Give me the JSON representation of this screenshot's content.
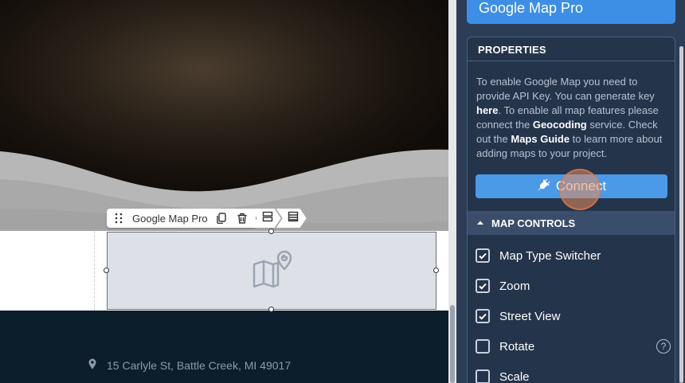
{
  "canvas": {
    "toolbar": {
      "element_label": "Google Map Pro"
    },
    "footer": {
      "address": "15 Carlyle St, Battle Creek, MI 49017"
    }
  },
  "panel": {
    "title": "Google Map Pro",
    "properties": {
      "header": "PROPERTIES",
      "desc_part1": "To enable Google Map you need to provide API Key. You can generate key ",
      "desc_link_here": "here",
      "desc_part2": ". To enable all map features please connect the ",
      "desc_geocoding": "Geocoding",
      "desc_part3": " service. Check out the ",
      "desc_maps_guide": "Maps Guide",
      "desc_part4": " to learn more about adding maps to your project.",
      "connect_label": "Connect"
    },
    "map_controls": {
      "header": "MAP CONTROLS",
      "items": [
        {
          "label": "Map Type Switcher",
          "checked": true
        },
        {
          "label": "Zoom",
          "checked": true
        },
        {
          "label": "Street View",
          "checked": true
        },
        {
          "label": "Rotate",
          "checked": false,
          "help": "?"
        },
        {
          "label": "Scale",
          "checked": false
        }
      ]
    }
  }
}
